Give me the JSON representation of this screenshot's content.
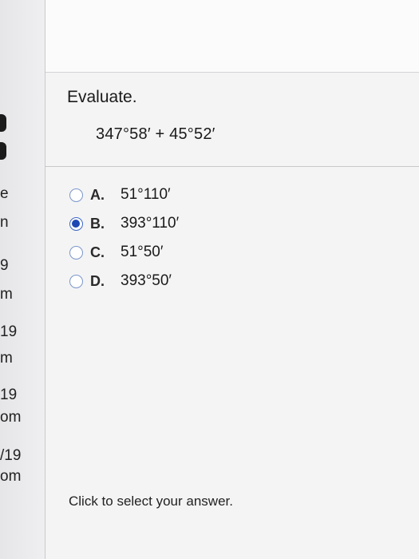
{
  "sidebar": {
    "items": [
      {
        "text": "e"
      },
      {
        "text": "n"
      },
      {
        "text": "9"
      },
      {
        "text": "m"
      },
      {
        "text": "19"
      },
      {
        "text": "m"
      },
      {
        "text": "19"
      },
      {
        "text": "om"
      },
      {
        "text": "/19"
      },
      {
        "text": "om"
      }
    ]
  },
  "question": {
    "prompt": "Evaluate.",
    "expression": "347°58′ + 45°52′"
  },
  "options": [
    {
      "letter": "A.",
      "text": "51°110′",
      "selected": false
    },
    {
      "letter": "B.",
      "text": "393°110′",
      "selected": true
    },
    {
      "letter": "C.",
      "text": "51°50′",
      "selected": false
    },
    {
      "letter": "D.",
      "text": "393°50′",
      "selected": false
    }
  ],
  "footer": {
    "note": "Click to select your answer."
  },
  "colors": {
    "radio_selected": "#1d48b3",
    "radio_border": "#7a96c9"
  }
}
